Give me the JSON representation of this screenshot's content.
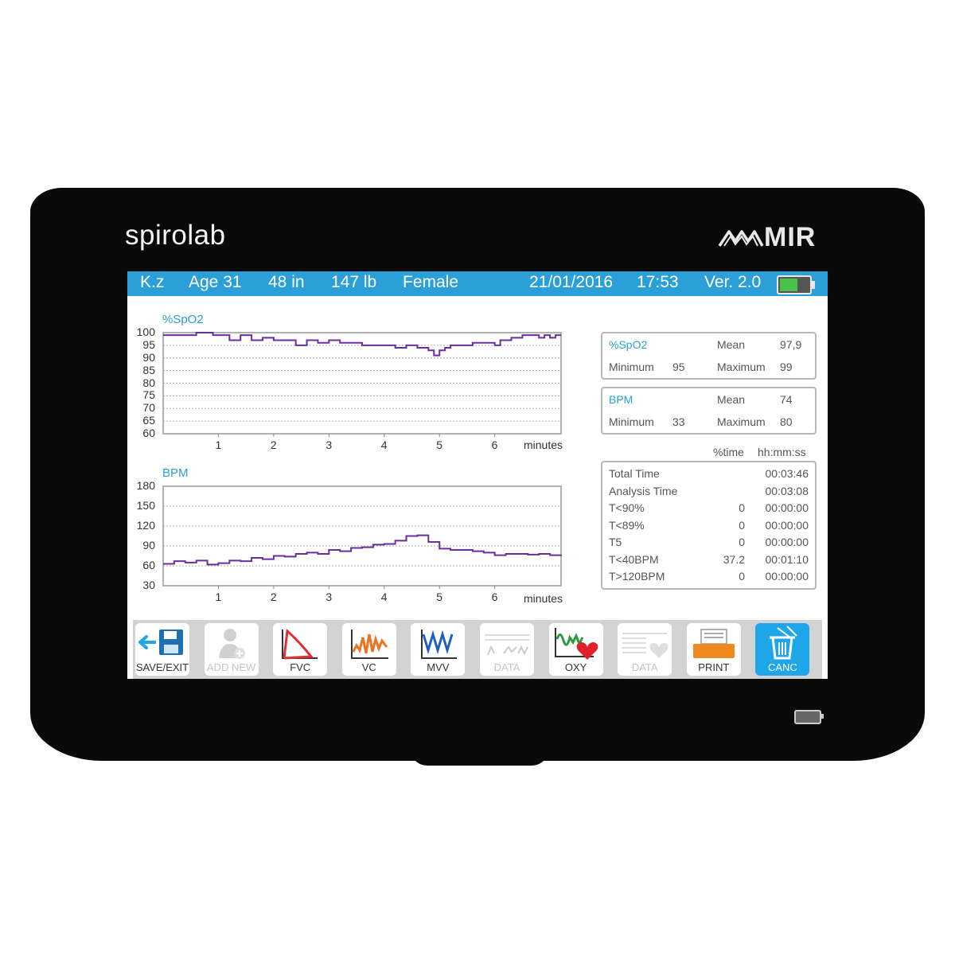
{
  "brand": {
    "name": "spirolab",
    "maker": "MIR"
  },
  "header": {
    "patient": "K.z",
    "age": "Age 31",
    "height": "48 in",
    "weight": "147 lb",
    "sex": "Female",
    "date": "21/01/2016",
    "time": "17:53",
    "version": "Ver. 2.0",
    "battery_level": 0.6
  },
  "colors": {
    "accent": "#2a9fd8",
    "trace": "#6a2ea0",
    "active_button": "#1fa6e8"
  },
  "chart_data": [
    {
      "type": "line",
      "title": "%SpO2",
      "xlabel": "minutes",
      "yticks": [
        100,
        95,
        90,
        85,
        80,
        75,
        70,
        65,
        60
      ],
      "xticks": [
        1,
        2,
        3,
        4,
        5,
        6
      ],
      "ylim": [
        60,
        100
      ],
      "xlim": [
        0,
        7.2
      ],
      "grid": true,
      "series": [
        {
          "x": [
            0,
            0.4,
            0.6,
            0.9,
            1.0,
            1.2,
            1.4,
            1.6,
            1.8,
            2.0,
            2.2,
            2.4,
            2.6,
            2.8,
            3.0,
            3.2,
            3.4,
            3.6,
            3.8,
            4.0,
            4.2,
            4.4,
            4.6,
            4.8,
            4.9,
            5.0,
            5.1,
            5.2,
            5.4,
            5.6,
            5.8,
            6.0,
            6.1,
            6.2,
            6.3,
            6.5,
            6.7,
            6.8,
            6.9,
            7.0,
            7.1,
            7.2
          ],
          "y": [
            99,
            99,
            100,
            99,
            99,
            97,
            99,
            97,
            98,
            97,
            97,
            95,
            97,
            96,
            97,
            96,
            96,
            95,
            95,
            95,
            94,
            95,
            94,
            93,
            91,
            93,
            94,
            95,
            95,
            96,
            96,
            95,
            97,
            97,
            98,
            99,
            99,
            98,
            99,
            98,
            99,
            99
          ]
        }
      ]
    },
    {
      "type": "line",
      "title": "BPM",
      "xlabel": "minutes",
      "yticks": [
        180,
        150,
        120,
        90,
        60,
        30
      ],
      "xticks": [
        1,
        2,
        3,
        4,
        5,
        6
      ],
      "ylim": [
        30,
        180
      ],
      "xlim": [
        0,
        7.2
      ],
      "grid": true,
      "series": [
        {
          "x": [
            0,
            0.2,
            0.4,
            0.6,
            0.8,
            1.0,
            1.2,
            1.4,
            1.6,
            1.8,
            2.0,
            2.2,
            2.4,
            2.6,
            2.8,
            3.0,
            3.2,
            3.4,
            3.6,
            3.8,
            4.0,
            4.2,
            4.4,
            4.6,
            4.8,
            5.0,
            5.2,
            5.4,
            5.6,
            5.8,
            6.0,
            6.2,
            6.4,
            6.6,
            6.8,
            7.0,
            7.2
          ],
          "y": [
            63,
            67,
            65,
            68,
            62,
            64,
            68,
            67,
            72,
            70,
            75,
            74,
            78,
            80,
            78,
            84,
            82,
            87,
            88,
            92,
            93,
            98,
            105,
            106,
            96,
            86,
            84,
            84,
            82,
            80,
            76,
            78,
            78,
            77,
            78,
            76,
            77
          ]
        }
      ]
    }
  ],
  "stats": {
    "spo2": {
      "title": "%SpO2",
      "mean_label": "Mean",
      "mean": "97,9",
      "min_label": "Minimum",
      "min": "95",
      "max_label": "Maximum",
      "max": "99"
    },
    "bpm": {
      "title": "BPM",
      "mean_label": "Mean",
      "mean": "74",
      "min_label": "Minimum",
      "min": "33",
      "max_label": "Maximum",
      "max": "80"
    }
  },
  "time_table": {
    "col_pct": "%time",
    "col_time": "hh:mm:ss",
    "rows": [
      {
        "label": "Total Time",
        "pct": "",
        "time": "00:03:46"
      },
      {
        "label": "Analysis Time",
        "pct": "",
        "time": "00:03:08"
      },
      {
        "label": "T<90%",
        "pct": "0",
        "time": "00:00:00"
      },
      {
        "label": "T<89%",
        "pct": "0",
        "time": "00:00:00"
      },
      {
        "label": "T5",
        "pct": "0",
        "time": "00:00:00"
      },
      {
        "label": "T<40BPM",
        "pct": "37.2",
        "time": "00:01:10"
      },
      {
        "label": "T>120BPM",
        "pct": "0",
        "time": "00:00:00"
      }
    ]
  },
  "toolbar": [
    {
      "label": "SAVE/EXIT",
      "icon": "save-exit-icon",
      "state": "enabled"
    },
    {
      "label": "ADD NEW",
      "icon": "add-user-icon",
      "state": "disabled"
    },
    {
      "label": "FVC",
      "icon": "fvc-curve-icon",
      "state": "enabled"
    },
    {
      "label": "VC",
      "icon": "vc-curve-icon",
      "state": "enabled"
    },
    {
      "label": "MVV",
      "icon": "mvv-curve-icon",
      "state": "enabled"
    },
    {
      "label": "DATA",
      "icon": "spirometry-data-icon",
      "state": "disabled"
    },
    {
      "label": "OXY",
      "icon": "oximetry-heart-icon",
      "state": "enabled"
    },
    {
      "label": "DATA",
      "icon": "oxy-data-icon",
      "state": "disabled"
    },
    {
      "label": "PRINT",
      "icon": "printer-icon",
      "state": "enabled"
    },
    {
      "label": "CANC",
      "icon": "trash-cancel-icon",
      "state": "active"
    }
  ]
}
